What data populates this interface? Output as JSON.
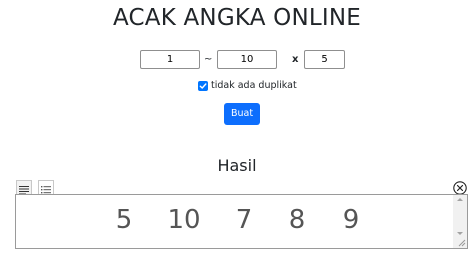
{
  "title": "ACAK ANGKA ONLINE",
  "form": {
    "from_value": "1",
    "tilde": "~",
    "to_value": "10",
    "times": "x",
    "count_value": "5",
    "no_duplicate_label": "tidak ada duplikat",
    "no_duplicate_checked": true,
    "submit_label": "Buat"
  },
  "result": {
    "heading": "Hasil",
    "numbers": [
      "5",
      "10",
      "7",
      "8",
      "9"
    ],
    "views": [
      "text-view-icon",
      "list-view-icon"
    ],
    "close_icon": "close-icon"
  },
  "colors": {
    "button": "#0d6efd",
    "checkbox": "#0075ff",
    "result_text": "#555555"
  }
}
